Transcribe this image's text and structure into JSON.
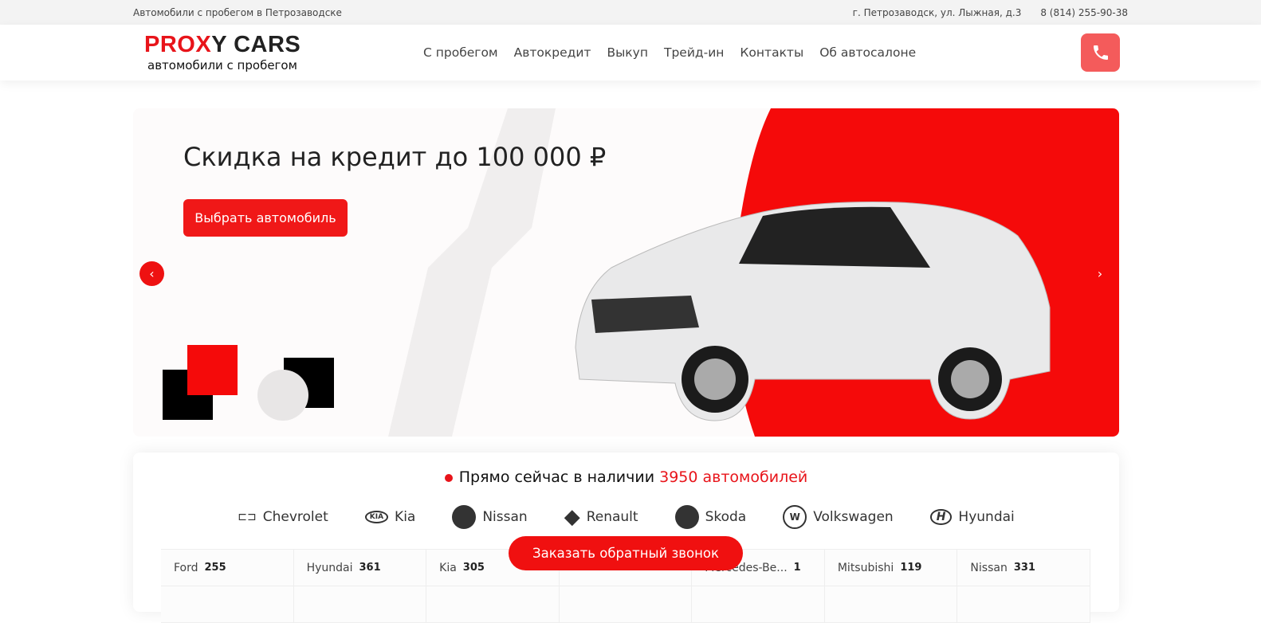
{
  "topbar": {
    "tagline": "Автомобили с пробегом в Петрозаводске",
    "address": "г. Петрозаводск, ул. Лыжная, д.3",
    "phone": "8 (814) 255-90-38"
  },
  "logo": {
    "part_red": "PROX",
    "part_dark": "Y CARS",
    "subtitle": "автомобили с пробегом"
  },
  "nav": [
    "С пробегом",
    "Автокредит",
    "Выкуп",
    "Трейд-ин",
    "Контакты",
    "Об автосалоне"
  ],
  "hero": {
    "title": "Скидка на кредит до 100 000 ₽",
    "button": "Выбрать автомобиль",
    "prev_icon": "chevron-left",
    "next_icon": "chevron-right"
  },
  "stock": {
    "title_prefix": "Прямо сейчас в наличии",
    "title_count": "3950 автомобилей",
    "brands": [
      "Chevrolet",
      "Kia",
      "Nissan",
      "Renault",
      "Skoda",
      "Volkswagen",
      "Hyundai"
    ],
    "cells": [
      {
        "name": "Ford",
        "count": "255"
      },
      {
        "name": "Hyundai",
        "count": "361"
      },
      {
        "name": "Kia",
        "count": "305"
      },
      {
        "name": "",
        "count": ""
      },
      {
        "name": "Mercedes-Be...",
        "count": "1"
      },
      {
        "name": "Mitsubishi",
        "count": "119"
      },
      {
        "name": "Nissan",
        "count": "331"
      }
    ]
  },
  "callback": "Заказать обратный звонок",
  "colors": {
    "accent": "#e8141a",
    "phone_button": "#f45b5b"
  }
}
